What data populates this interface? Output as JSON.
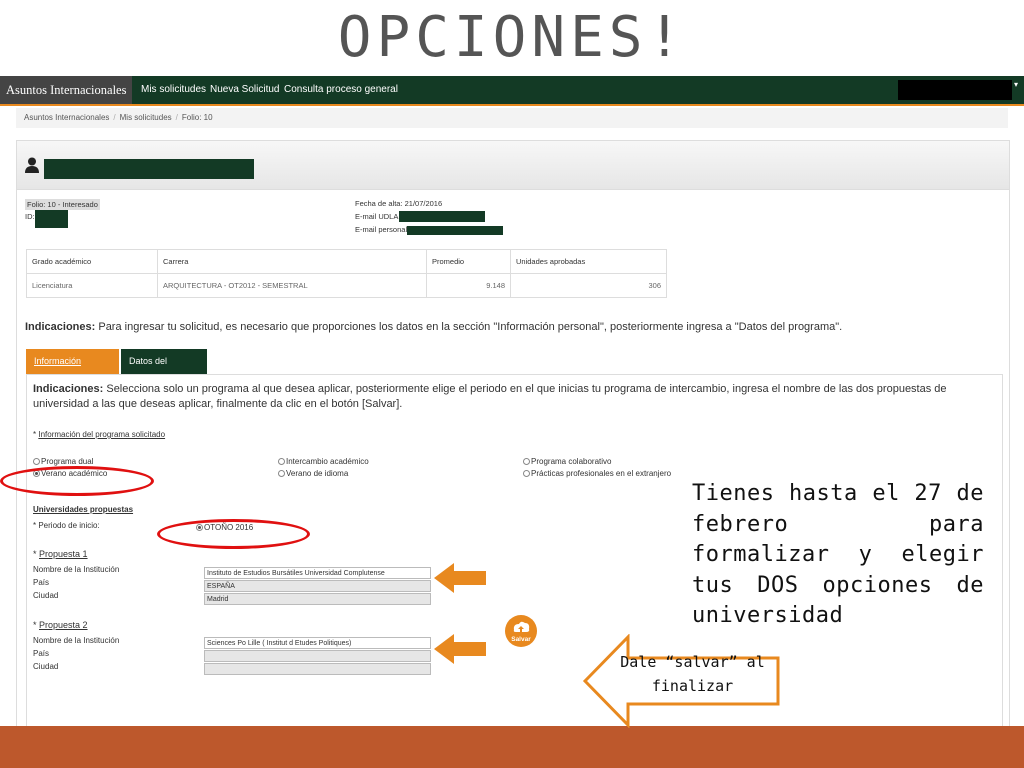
{
  "slide": {
    "title": "OPCIONES!",
    "annotation": "Tienes hasta el 27 de febrero para formalizar y elegir tus DOS opciones de universidad",
    "callout": "Dale “salvar” al finalizar"
  },
  "navbar": {
    "brand": "Asuntos Internacionales",
    "links": [
      "Mis solicitudes",
      "Nueva Solicitud",
      "Consulta proceso general"
    ],
    "user": ""
  },
  "breadcrumb": [
    "Asuntos Internacionales",
    "Mis solicitudes",
    "Folio: 10"
  ],
  "record": {
    "folio": "Folio: 10 - Interesado",
    "id_label": "ID:",
    "fecha_alta": "Fecha de alta: 21/07/2016",
    "email_udlap_label": "E-mail UDLAP:",
    "email_personal_label": "E-mail personal:"
  },
  "table": {
    "headers": [
      "Grado académico",
      "Carrera",
      "Promedio",
      "Unidades aprobadas"
    ],
    "row": [
      "Licenciatura",
      "ARQUITECTURA - OT2012 - SEMESTRAL",
      "9.148",
      "306"
    ]
  },
  "indicaciones": {
    "label": "Indicaciones:",
    "text": " Para ingresar tu solicitud, es necesario que proporciones los datos en la sección \"Información personal\", posteriormente ingresa a \"Datos del programa\"."
  },
  "tabs": [
    "Información personal",
    "Datos del programa"
  ],
  "form": {
    "instr_label": "Indicaciones:",
    "instr_text": " Selecciona solo un programa al que desea aplicar, posteriormente elige el periodo en el que inicias tu programa de intercambio, ingresa el nombre de las dos propuestas de universidad a las que deseas aplicar, finalmente da clic en el botón [Salvar].",
    "program_heading": "Información del programa solicitado",
    "program_options": [
      "Programa dual",
      "Verano académico",
      "Intercambio académico",
      "Verano de idioma",
      "Programa colaborativo",
      "Prácticas profesionales en el extranjero"
    ],
    "universities_heading": "Universidades propuestas",
    "period_label": "Periodo de inicio:",
    "period_value": "OTOÑO 2016",
    "proposal1_title": "Propuesta 1",
    "proposal2_title": "Propuesta 2",
    "institution_label": "Nombre de la Institución",
    "country_label": "País",
    "city_label": "Ciudad",
    "p1_institution": "Instituto de Estudios Bursátiles Universidad Complutense",
    "p1_country": "ESPAÑA",
    "p1_city": "Madrid",
    "p2_institution": "Sciences Po Lille ( Institut d Etudes Politiques)",
    "p2_country": "",
    "p2_city": "",
    "save_label": "Salvar"
  },
  "colors": {
    "nav_green": "#133a25",
    "accent_orange": "#e8891f",
    "footer_rust": "#bd582c",
    "highlight_red": "#e01010"
  }
}
